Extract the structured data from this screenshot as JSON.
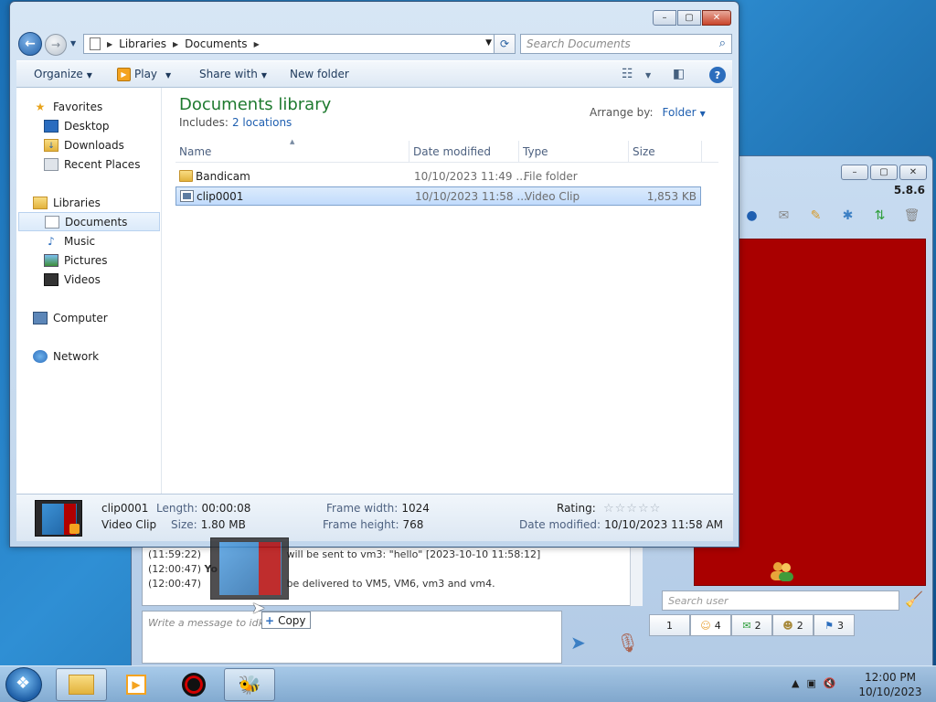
{
  "explorer": {
    "breadcrumb": [
      "Libraries",
      "Documents"
    ],
    "search_placeholder": "Search Documents",
    "toolbar": {
      "organize": "Organize",
      "play": "Play",
      "share_with": "Share with",
      "new_folder": "New folder"
    },
    "nav": {
      "favorites": "Favorites",
      "desktop": "Desktop",
      "downloads": "Downloads",
      "recent_places": "Recent Places",
      "libraries": "Libraries",
      "documents": "Documents",
      "music": "Music",
      "pictures": "Pictures",
      "videos": "Videos",
      "computer": "Computer",
      "network": "Network"
    },
    "library_title": "Documents library",
    "includes_label": "Includes:",
    "includes_link": "2 locations",
    "arrange_by_label": "Arrange by:",
    "arrange_by_value": "Folder",
    "columns": {
      "name": "Name",
      "date_modified": "Date modified",
      "type": "Type",
      "size": "Size"
    },
    "files": [
      {
        "name": "Bandicam",
        "date": "10/10/2023 11:49 ...",
        "type": "File folder",
        "size": "",
        "icon": "folder-icon"
      },
      {
        "name": "clip0001",
        "date": "10/10/2023 11:58 ...",
        "type": "Video Clip",
        "size": "1,853 KB",
        "icon": "video-icon"
      }
    ],
    "details": {
      "name": "clip0001",
      "kind": "Video Clip",
      "length_label": "Length:",
      "length": "00:00:08",
      "size_label": "Size:",
      "size": "1.80 MB",
      "frame_width_label": "Frame width:",
      "frame_width": "1024",
      "frame_height_label": "Frame height:",
      "frame_height": "768",
      "rating_label": "Rating:",
      "rating_stars": "☆☆☆☆☆",
      "date_modified_label": "Date modified:",
      "date_modified": "10/10/2023 11:58 AM"
    }
  },
  "chat": {
    "version": "5.8.6",
    "messages": [
      {
        "time": "(11:59:22)",
        "text": "will be sent to vm3: \"hello\" [2023-10-10 11:58:12]"
      },
      {
        "time": "(12:00:47)",
        "text": "Yo"
      },
      {
        "time": "(12:00:47)",
        "text": "be delivered to VM5, VM6, vm3 and vm4."
      }
    ],
    "message_placeholder": "Write a message to idk",
    "search_user_placeholder": "Search user",
    "user_tabs": [
      "1",
      "4",
      "2",
      "2",
      "3"
    ]
  },
  "drag": {
    "tooltip": "Copy"
  },
  "taskbar": {
    "time": "12:00 PM",
    "date": "10/10/2023"
  }
}
